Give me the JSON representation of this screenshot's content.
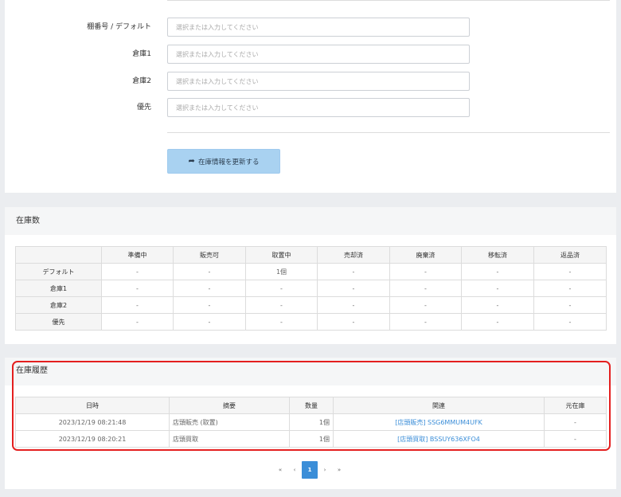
{
  "form": {
    "fields": [
      {
        "label": "棚番号 / デフォルト",
        "placeholder": "選択または入力してください"
      },
      {
        "label": "倉庫1",
        "placeholder": "選択または入力してください"
      },
      {
        "label": "倉庫2",
        "placeholder": "選択または入力してください"
      },
      {
        "label": "優先",
        "placeholder": "選択または入力してください"
      }
    ],
    "update_button": "在庫情報を更新する"
  },
  "stock": {
    "title": "在庫数",
    "columns": [
      "",
      "準備中",
      "販売可",
      "取置中",
      "売却済",
      "廃棄済",
      "移転済",
      "返品済"
    ],
    "rows": [
      {
        "name": "デフォルト",
        "cells": [
          "-",
          "-",
          "1個",
          "-",
          "-",
          "-",
          "-"
        ]
      },
      {
        "name": "倉庫1",
        "cells": [
          "-",
          "-",
          "-",
          "-",
          "-",
          "-",
          "-"
        ]
      },
      {
        "name": "倉庫2",
        "cells": [
          "-",
          "-",
          "-",
          "-",
          "-",
          "-",
          "-"
        ]
      },
      {
        "name": "優先",
        "cells": [
          "-",
          "-",
          "-",
          "-",
          "-",
          "-",
          "-"
        ]
      }
    ]
  },
  "history": {
    "title": "在庫履歴",
    "columns": [
      "日時",
      "摘要",
      "数量",
      "関連",
      "元在庫"
    ],
    "rows": [
      {
        "datetime": "2023/12/19 08:21:48",
        "summary": "店頭販売 (取置)",
        "qty": "1個",
        "related": "[店頭販売] SSG6MMUM4UFK",
        "origin": "-"
      },
      {
        "datetime": "2023/12/19 08:20:21",
        "summary": "店頭買取",
        "qty": "1個",
        "related": "[店頭買取] BSSUY636XFO4",
        "origin": "-"
      }
    ]
  },
  "pagination": {
    "first": "«",
    "prev": "‹",
    "current": "1",
    "next": "›",
    "last": "»"
  },
  "colors": {
    "accent": "#3b8ed8",
    "button_bg": "#a9d2f1",
    "highlight_border": "#e41f1f"
  },
  "icons": {
    "update_button_icon": "share-arrow-icon"
  }
}
